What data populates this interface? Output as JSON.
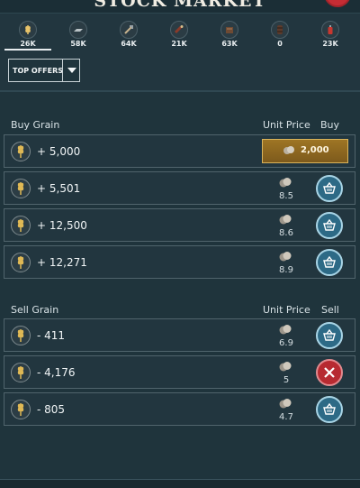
{
  "title": "STOCK MARKET",
  "resources": [
    {
      "icon": "grain-icon",
      "amount": "26K",
      "active": true
    },
    {
      "icon": "iron-icon",
      "amount": "58K"
    },
    {
      "icon": "tools-icon",
      "amount": "64K"
    },
    {
      "icon": "wine-icon",
      "amount": "21K"
    },
    {
      "icon": "furniture-icon",
      "amount": "63K"
    },
    {
      "icon": "barrel-icon",
      "amount": "0"
    },
    {
      "icon": "lantern-icon",
      "amount": "23K"
    }
  ],
  "filter": {
    "label": "TOP OFFERS"
  },
  "buy": {
    "title": "Buy Grain",
    "col_price": "Unit Price",
    "col_action": "Buy",
    "featured": {
      "qty": "+ 5,000",
      "button_value": "2,000"
    },
    "rows": [
      {
        "qty": "+ 5,501",
        "price": "8.5"
      },
      {
        "qty": "+ 12,500",
        "price": "8.6"
      },
      {
        "qty": "+ 12,271",
        "price": "8.9"
      }
    ]
  },
  "sell": {
    "title": "Sell Grain",
    "col_price": "Unit Price",
    "col_action": "Sell",
    "rows": [
      {
        "qty": "- 411",
        "price": "6.9",
        "action": "buy-basket"
      },
      {
        "qty": "- 4,176",
        "price": "5",
        "action": "cancel"
      },
      {
        "qty": "- 805",
        "price": "4.7",
        "action": "buy-basket"
      }
    ]
  },
  "colors": {
    "accent_blue": "#2d6a86",
    "cancel_red": "#b72a31",
    "gold": "#9e7524"
  }
}
